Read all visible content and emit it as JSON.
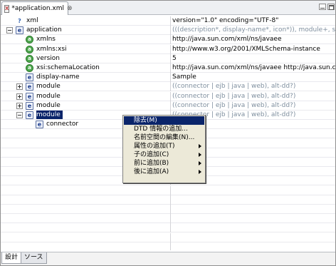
{
  "tab": {
    "label": "*application.xml",
    "close": "⊗",
    "icon": "xml-file-icon"
  },
  "rows": [
    {
      "name": "xml",
      "value": "version=\"1.0\" encoding=\"UTF-8\"",
      "icon": "processing-instruction-icon",
      "icon_glyph": "?-?",
      "expander": "none",
      "value_style": "normal"
    },
    {
      "name": "application",
      "value": "(((description*, display-name*, icon*)), module+, security-rol",
      "icon": "element-icon",
      "icon_glyph": "e",
      "expander": "minus",
      "value_style": "gray"
    },
    {
      "name": "xmlns",
      "value": "http://java.sun.com/xml/ns/javaee",
      "icon": "attribute-icon",
      "icon_glyph": "a",
      "expander": "none",
      "value_style": "normal"
    },
    {
      "name": "xmlns:xsi",
      "value": "http://www.w3.org/2001/XMLSchema-instance",
      "icon": "attribute-icon",
      "icon_glyph": "a",
      "expander": "none",
      "value_style": "normal"
    },
    {
      "name": "version",
      "value": "5",
      "icon": "attribute-icon",
      "icon_glyph": "a",
      "expander": "none",
      "value_style": "normal"
    },
    {
      "name": "xsi:schemaLocation",
      "value": "http://java.sun.com/xml/ns/javaee http://java.sun.com/xml",
      "icon": "attribute-icon",
      "icon_glyph": "a",
      "expander": "none",
      "value_style": "normal"
    },
    {
      "name": "display-name",
      "value": "Sample",
      "icon": "element-icon",
      "icon_glyph": "e",
      "expander": "none",
      "value_style": "normal"
    },
    {
      "name": "module",
      "value": "((connector | ejb | java | web), alt-dd?)",
      "icon": "element-icon",
      "icon_glyph": "e",
      "expander": "plus",
      "value_style": "gray"
    },
    {
      "name": "module",
      "value": "((connector | ejb | java | web), alt-dd?)",
      "icon": "element-icon",
      "icon_glyph": "e",
      "expander": "plus",
      "value_style": "gray"
    },
    {
      "name": "module",
      "value": "((connector | ejb | java | web), alt-dd?)",
      "icon": "element-icon",
      "icon_glyph": "e",
      "expander": "plus",
      "value_style": "gray"
    },
    {
      "name": "module",
      "value": "((connector | ejb | java | web), alt-dd?)",
      "icon": "element-icon",
      "icon_glyph": "e",
      "expander": "minus",
      "value_style": "gray",
      "selected": true
    },
    {
      "name": "connector",
      "value": "",
      "icon": "element-icon",
      "icon_glyph": "e",
      "expander": "none",
      "value_style": "normal"
    }
  ],
  "context_menu": {
    "items": [
      {
        "label": "除去(M)",
        "submenu": false,
        "highlight": true
      },
      {
        "label": "DTD 情報の追加...",
        "submenu": false
      },
      {
        "label": "名前空間の編集(N)...",
        "submenu": false
      },
      {
        "label": "属性の追加(T)",
        "submenu": true
      },
      {
        "label": "子の追加(C)",
        "submenu": true
      },
      {
        "label": "前に追加(B)",
        "submenu": true
      },
      {
        "label": "後に追加(A)",
        "submenu": true
      }
    ]
  },
  "bottom_tabs": [
    {
      "label": "設計",
      "active": true
    },
    {
      "label": "ソース",
      "active": false
    }
  ],
  "colors": {
    "selection": "#0a246a",
    "menu_bg": "#ece9d8",
    "gray_value": "#7f8f9f"
  }
}
